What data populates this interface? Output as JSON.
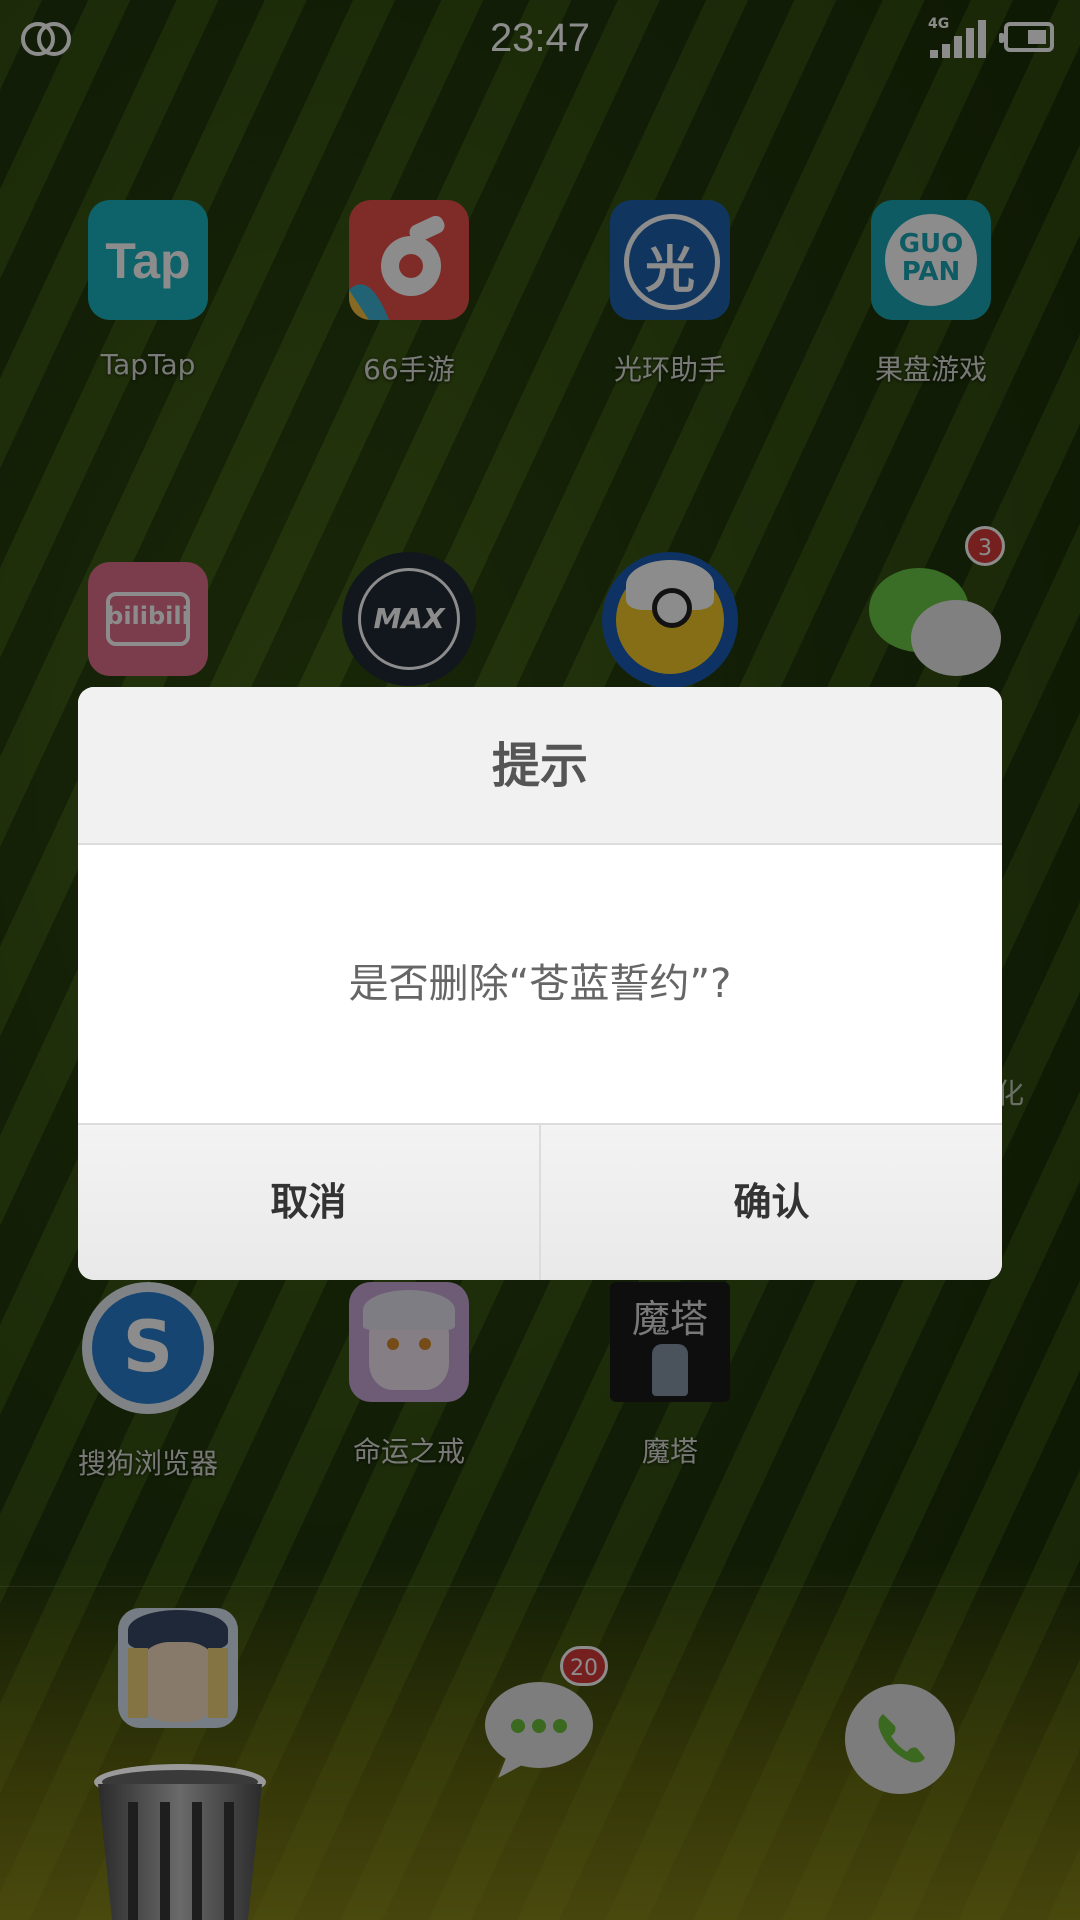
{
  "status_bar": {
    "time": "23:47",
    "network": "4G"
  },
  "apps_row1": [
    {
      "label": "TapTap",
      "icon": "taptap-icon",
      "icon_text": "Tap",
      "color": "#1bb3c0"
    },
    {
      "label": "66手游",
      "icon": "66-shouyou-icon",
      "icon_text": "6",
      "color": "#e8504a"
    },
    {
      "label": "光环助手",
      "icon": "guanghuan-icon",
      "icon_text": "光",
      "color": "#1e63b0"
    },
    {
      "label": "果盘游戏",
      "icon": "guopan-icon",
      "icon_text": "GUO PAN",
      "color": "#1aa6b5"
    }
  ],
  "apps_row2": [
    {
      "label": "",
      "icon": "bilibili-icon",
      "icon_text": "bilibili",
      "color": "#e06f8b"
    },
    {
      "label": "",
      "icon": "max-icon",
      "icon_text": "MAX",
      "color": "#1f2a36"
    },
    {
      "label": "",
      "icon": "duck-app-icon",
      "icon_text": "",
      "color": "#1a5bb5"
    },
    {
      "label": "",
      "icon": "wechat-icon",
      "icon_text": "",
      "color": "#6bc646",
      "badge": "3"
    }
  ],
  "apps_row4": [
    {
      "label": "搜狗浏览器",
      "icon": "sogou-browser-icon",
      "icon_text": "S",
      "color": "#2a7fd0"
    },
    {
      "label": "命运之戒",
      "icon": "mingyun-zhijie-icon",
      "icon_text": "",
      "color": "#c9a6d6"
    },
    {
      "label": "魔塔",
      "icon": "mota-icon",
      "icon_text": "魔塔",
      "color": "#1a1a1a"
    }
  ],
  "partial_label": "化",
  "dock": {
    "messages_badge": "20"
  },
  "dialog": {
    "title": "提示",
    "message": "是否删除“苍蓝誓约”?",
    "cancel": "取消",
    "confirm": "确认"
  }
}
